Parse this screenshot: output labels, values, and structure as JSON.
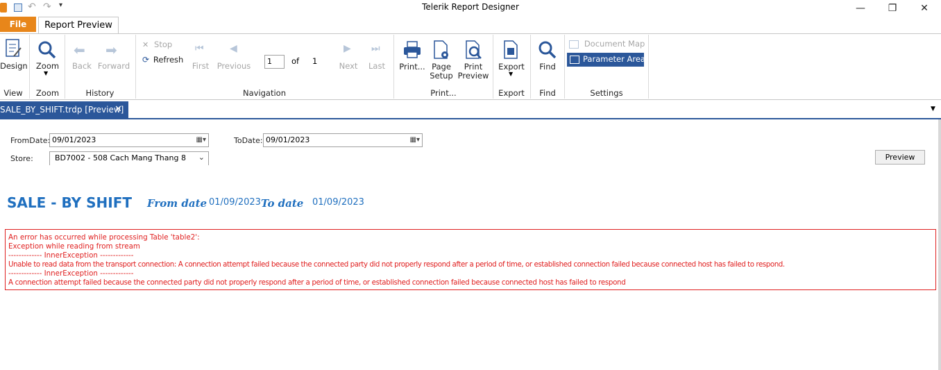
{
  "window": {
    "title": "Telerik Report Designer"
  },
  "ribbon": {
    "tabs": {
      "file": "File",
      "report_preview": "Report Preview"
    },
    "groups": {
      "view": "View",
      "zoom": "Zoom",
      "history": "History",
      "navigation": "Navigation",
      "print": "Print...",
      "export": "Export",
      "find": "Find",
      "settings": "Settings"
    },
    "buttons": {
      "design": "Design",
      "zoom": "Zoom",
      "back": "Back",
      "forward": "Forward",
      "stop": "Stop",
      "refresh": "Refresh",
      "first": "First",
      "previous": "Previous",
      "next": "Next",
      "last": "Last",
      "print": "Print...",
      "page_setup_1": "Page",
      "page_setup_2": "Setup",
      "print_preview_1": "Print",
      "print_preview_2": "Preview",
      "export": "Export",
      "find": "Find",
      "document_map": "Document Map",
      "parameter_area": "Parameter Area"
    },
    "navigation": {
      "current_page": "1",
      "of_label": "of",
      "total_pages": "1"
    }
  },
  "document_tab": {
    "label": "SALE_BY_SHIFT.trdp [Preview]"
  },
  "parameters": {
    "from_date_label": "FromDate:",
    "from_date_value": "09/01/2023",
    "to_date_label": "ToDate:",
    "to_date_value": "09/01/2023",
    "store_label": "Store:",
    "store_value": "BD7002 - 508 Cach Mang Thang 8",
    "preview_button": "Preview"
  },
  "report": {
    "title": "SALE - BY SHIFT",
    "from_date_label": "From date",
    "from_date_value": "01/09/2023",
    "to_date_label": "To date",
    "to_date_value": "01/09/2023",
    "error_lines": [
      "An error has occurred while processing Table 'table2':",
      "Exception while reading from stream",
      "------------- InnerException -------------",
      "Unable to read data from the transport connection: A connection attempt failed because the connected party did not properly respond after a period of time, or established connection failed because connected host has failed to respond.",
      "------------- InnerException -------------",
      "A connection attempt failed because the connected party did not properly respond after a period of time, or established connection failed because connected host has failed to respond"
    ]
  },
  "colors": {
    "accent": "#2b579a",
    "file_tab": "#e8861a",
    "report_blue": "#1f6fbf",
    "error": "#e02020"
  }
}
